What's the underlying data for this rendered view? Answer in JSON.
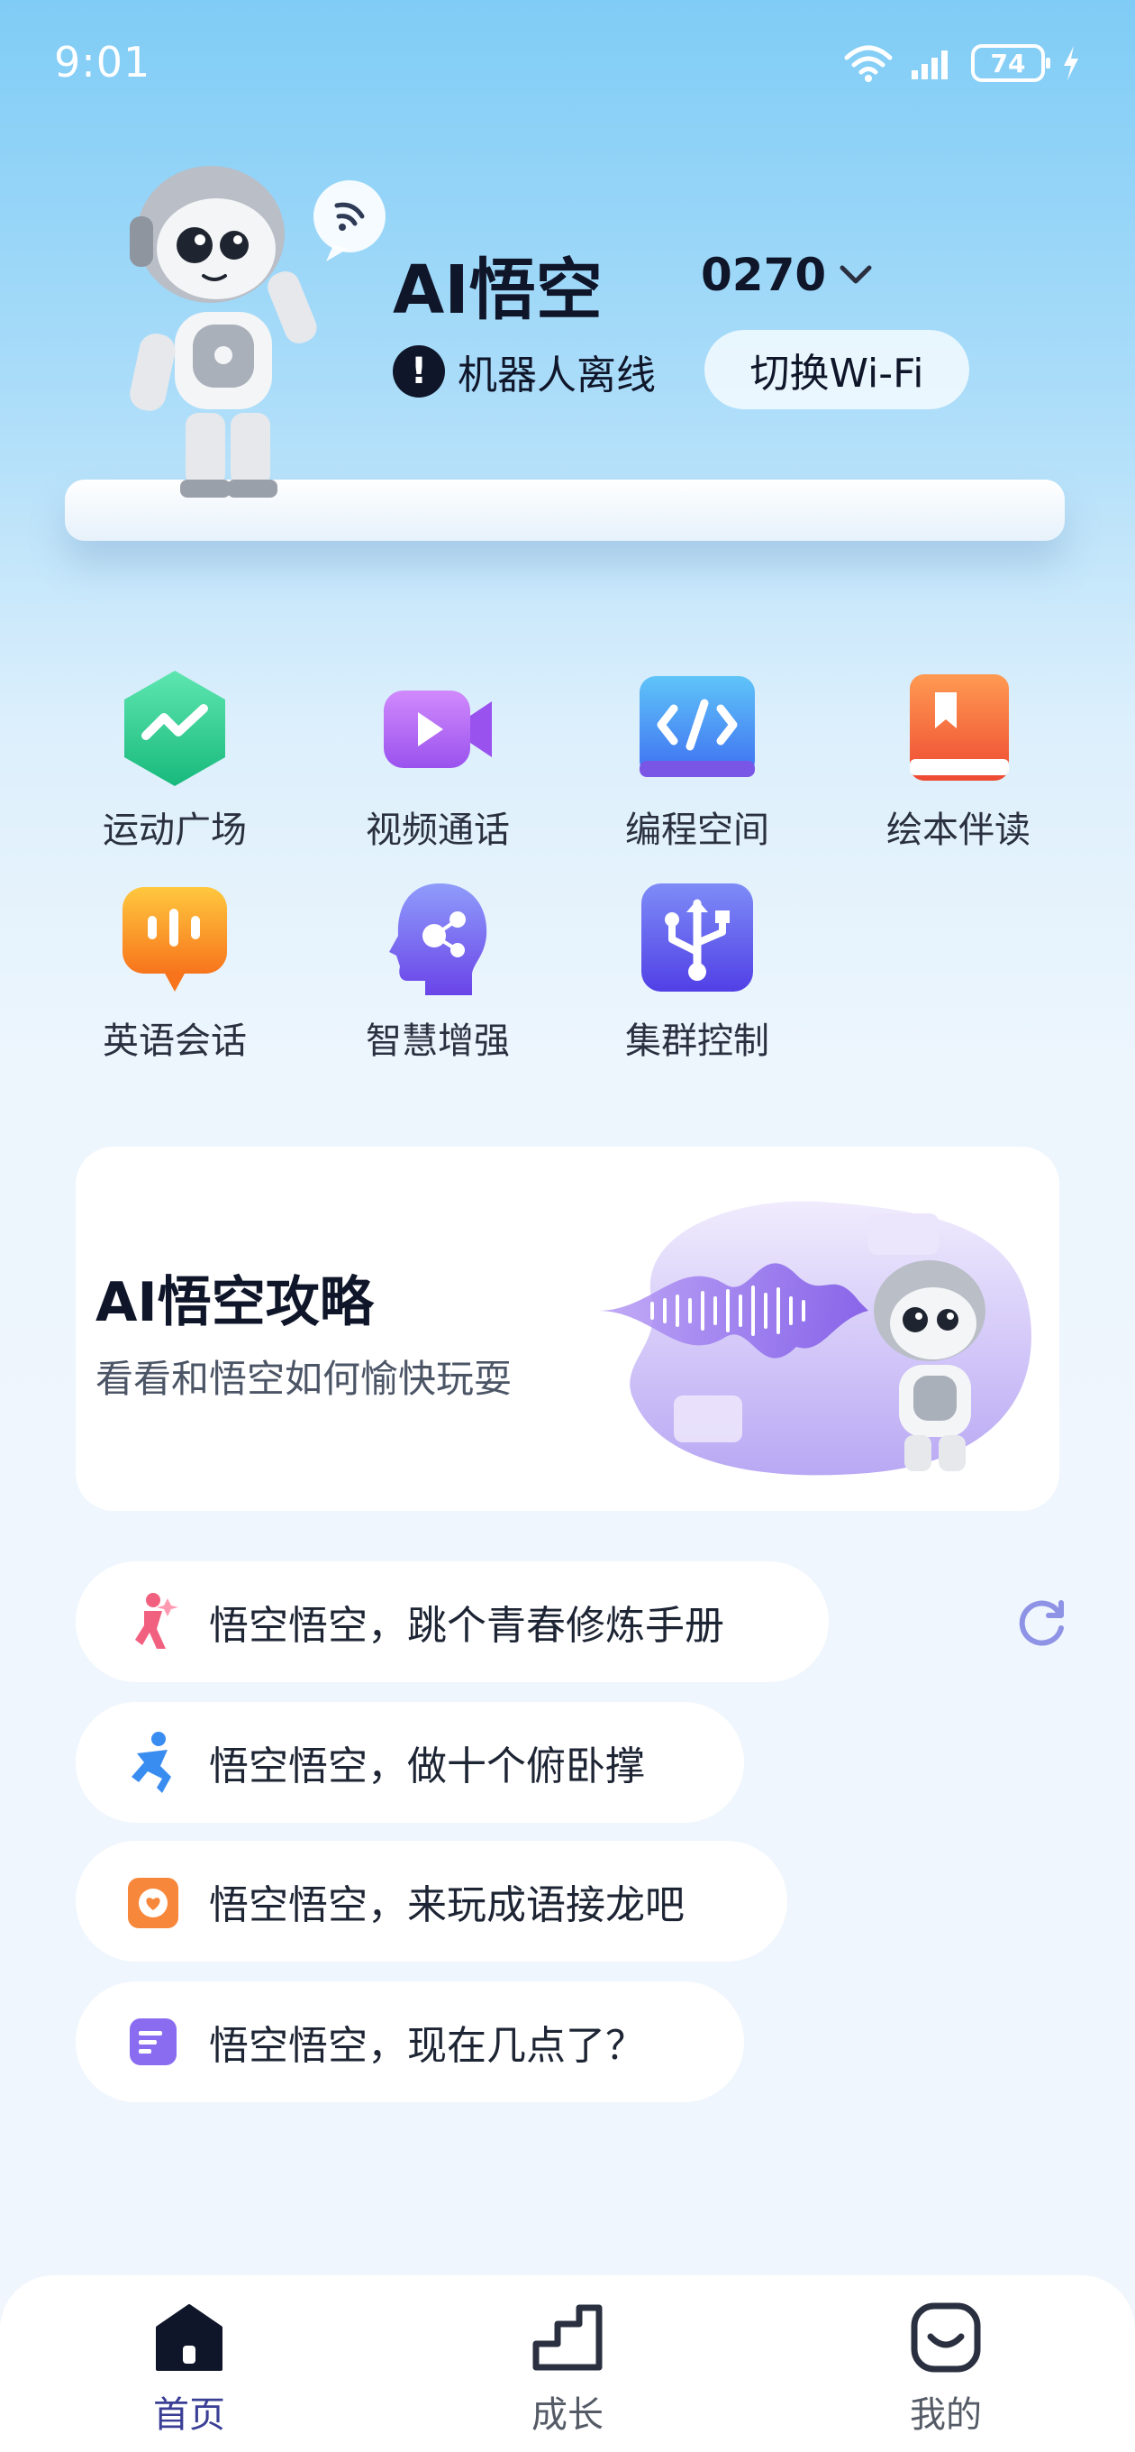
{
  "status_bar": {
    "time": "9:01",
    "battery": "74"
  },
  "header": {
    "title": "AI悟空",
    "device_id": "0270",
    "offline_text": "机器人离线",
    "offline_icon": "exclamation-icon",
    "wifi_button": "切换Wi-Fi"
  },
  "features": [
    {
      "label": "运动广场",
      "icon": "activity-icon",
      "color": "#2bc98f"
    },
    {
      "label": "视频通话",
      "icon": "video-camera-icon",
      "color": "#a86df2"
    },
    {
      "label": "编程空间",
      "icon": "code-icon",
      "color": "#4a8cf5"
    },
    {
      "label": "绘本伴读",
      "icon": "book-icon",
      "color": "#f46a3c"
    },
    {
      "label": "英语会话",
      "icon": "chat-bubble-icon",
      "color": "#f8a12a"
    },
    {
      "label": "智慧增强",
      "icon": "brain-head-icon",
      "color": "#7364f0"
    },
    {
      "label": "集群控制",
      "icon": "usb-cluster-icon",
      "color": "#5b63ef"
    }
  ],
  "guide": {
    "title": "AI悟空攻略",
    "subtitle": "看看和悟空如何愉快玩耍"
  },
  "suggestions": [
    {
      "text": "悟空悟空，跳个青春修炼手册",
      "icon": "dance-icon",
      "color": "#f2607f"
    },
    {
      "text": "悟空悟空，做十个俯卧撑",
      "icon": "exercise-icon",
      "color": "#3a8df0"
    },
    {
      "text": "悟空悟空，来玩成语接龙吧",
      "icon": "idiom-game-icon",
      "color": "#f7873a"
    },
    {
      "text": "悟空悟空，现在几点了？",
      "icon": "note-icon",
      "color": "#8a6cf0"
    }
  ],
  "nav": {
    "home": "首页",
    "growth": "成长",
    "mine": "我的"
  }
}
